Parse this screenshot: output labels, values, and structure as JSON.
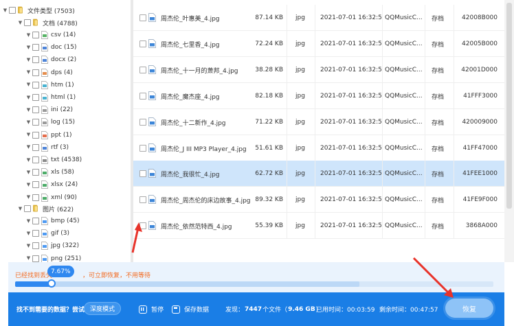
{
  "tree": {
    "root": {
      "label": "文件类型 (7503)"
    },
    "docs": {
      "label": "文档 (4788)"
    },
    "doc_items": [
      {
        "label": "csv (14)",
        "icon": "csv-file-icon"
      },
      {
        "label": "doc (15)",
        "icon": "doc-file-icon"
      },
      {
        "label": "docx (2)",
        "icon": "docx-file-icon"
      },
      {
        "label": "dps (4)",
        "icon": "dps-file-icon"
      },
      {
        "label": "htm (1)",
        "icon": "htm-file-icon"
      },
      {
        "label": "html (1)",
        "icon": "html-file-icon"
      },
      {
        "label": "ini (22)",
        "icon": "ini-file-icon"
      },
      {
        "label": "log (15)",
        "icon": "log-file-icon"
      },
      {
        "label": "ppt (1)",
        "icon": "ppt-file-icon"
      },
      {
        "label": "rtf (3)",
        "icon": "rtf-file-icon"
      },
      {
        "label": "txt (4538)",
        "icon": "txt-file-icon"
      },
      {
        "label": "xls (58)",
        "icon": "xls-file-icon"
      },
      {
        "label": "xlsx (24)",
        "icon": "xlsx-file-icon"
      },
      {
        "label": "xml (90)",
        "icon": "xml-file-icon"
      }
    ],
    "images": {
      "label": "图片 (622)"
    },
    "image_items": [
      {
        "label": "bmp (45)",
        "icon": "bmp-file-icon"
      },
      {
        "label": "gif (3)",
        "icon": "gif-file-icon"
      },
      {
        "label": "jpg (322)",
        "icon": "jpg-file-icon"
      },
      {
        "label": "png (251)",
        "icon": "png-file-icon"
      }
    ]
  },
  "files": [
    {
      "name": "周杰伦_叶惠美_4.jpg",
      "size": "87.14 KB",
      "ext": "jpg",
      "time": "2021-07-01 16:32:58",
      "source": "QQMusicC...",
      "status": "存档",
      "offset": "42008B000",
      "selected": false
    },
    {
      "name": "周杰伦_七里香_4.jpg",
      "size": "72.24 KB",
      "ext": "jpg",
      "time": "2021-07-01 16:32:58",
      "source": "QQMusicC...",
      "status": "存档",
      "offset": "42005B000",
      "selected": false
    },
    {
      "name": "周杰伦_十一月的萧邦_4.jpg",
      "size": "38.28 KB",
      "ext": "jpg",
      "time": "2021-07-01 16:32:57",
      "source": "QQMusicC...",
      "status": "存档",
      "offset": "42001D000",
      "selected": false
    },
    {
      "name": "周杰伦_魔杰座_4.jpg",
      "size": "82.18 KB",
      "ext": "jpg",
      "time": "2021-07-01 16:32:57",
      "source": "QQMusicC...",
      "status": "存档",
      "offset": "41FFF3000",
      "selected": false
    },
    {
      "name": "周杰伦_十二新作_4.jpg",
      "size": "71.22 KB",
      "ext": "jpg",
      "time": "2021-07-01 16:32:57",
      "source": "QQMusicC...",
      "status": "存档",
      "offset": "420009000",
      "selected": false
    },
    {
      "name": "周杰伦_J III MP3 Player_4.jpg",
      "size": "51.61 KB",
      "ext": "jpg",
      "time": "2021-07-01 16:32:56",
      "source": "QQMusicC...",
      "status": "存档",
      "offset": "41FF47000",
      "selected": false
    },
    {
      "name": "周杰伦_我很忙_4.jpg",
      "size": "62.72 KB",
      "ext": "jpg",
      "time": "2021-07-01 16:32:56",
      "source": "QQMusicC...",
      "status": "存档",
      "offset": "41FEE1000",
      "selected": true
    },
    {
      "name": "周杰伦_周杰伦的床边故事_4.jpg",
      "size": "89.32 KB",
      "ext": "jpg",
      "time": "2021-07-01 16:32:55",
      "source": "QQMusicC...",
      "status": "存档",
      "offset": "41FE9F000",
      "selected": false
    },
    {
      "name": "周杰伦_依然范特西_4.jpg",
      "size": "55.39 KB",
      "ext": "jpg",
      "time": "2021-07-01 16:32:54",
      "source": "QQMusicC...",
      "status": "存档",
      "offset": "3868A000",
      "selected": false
    }
  ],
  "progress": {
    "text_head": "已经找到丢失",
    "text_tail": "，可立即恢复，不用等待",
    "percent_label": "7.67%",
    "fraction": 0.0767
  },
  "bottom": {
    "help_text": "找不到需要的数据？尝试",
    "deep_label": "深度模式",
    "pause_label": "暂停",
    "save_label": "保存数据",
    "found_prefix": "发现：",
    "found_count": "7447",
    "found_mid": "个文件（",
    "found_size": "9.46 GB",
    "found_suffix": "）",
    "elapsed": "已用时间：00:03:59",
    "remaining": "剩余时间：00:47:57",
    "recover_label": "恢复"
  },
  "colors": {
    "accent": "#1a7ee6",
    "selected_row": "#cfe5fb",
    "progress_text": "#f36b21",
    "annotation_arrow": "#e8332a"
  }
}
